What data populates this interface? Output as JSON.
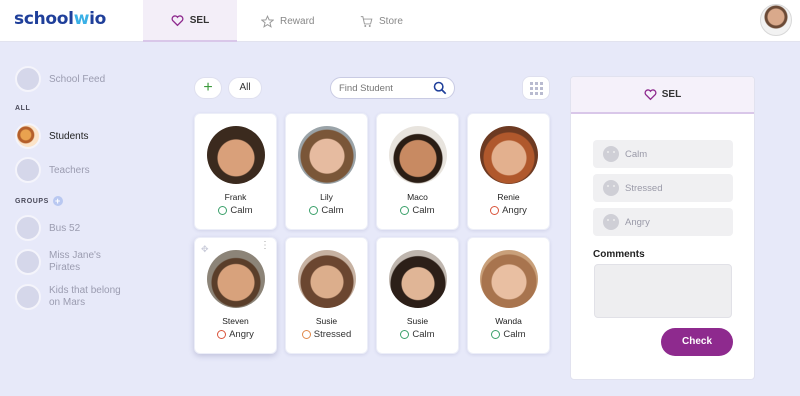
{
  "app": {
    "logo_part1": "school",
    "logo_part2": "w",
    "logo_part3": "io"
  },
  "nav": {
    "tabs": [
      {
        "label": "SEL",
        "icon": "heart-icon",
        "active": true
      },
      {
        "label": "Reward",
        "icon": "star-icon",
        "active": false
      },
      {
        "label": "Store",
        "icon": "cart-icon",
        "active": false
      }
    ]
  },
  "sidebar": {
    "school_feed": "School Feed",
    "all_section": "ALL",
    "students": "Students",
    "teachers": "Teachers",
    "groups_section": "GROUPS",
    "groups": [
      "Bus 52",
      "Miss Jane's Pirates",
      "Kids that belong on Mars"
    ]
  },
  "toolbar": {
    "add_label": "+",
    "all_label": "All",
    "search_placeholder": "Find Student"
  },
  "students": [
    {
      "name": "Frank",
      "mood": "Calm"
    },
    {
      "name": "Lily",
      "mood": "Calm"
    },
    {
      "name": "Maco",
      "mood": "Calm"
    },
    {
      "name": "Renie",
      "mood": "Angry"
    },
    {
      "name": "Steven",
      "mood": "Angry"
    },
    {
      "name": "Susie",
      "mood": "Stressed"
    },
    {
      "name": "Susie",
      "mood": "Calm"
    },
    {
      "name": "Wanda",
      "mood": "Calm"
    }
  ],
  "panel": {
    "title": "SEL",
    "options": [
      "Calm",
      "Stressed",
      "Angry"
    ],
    "comments_label": "Comments",
    "check_label": "Check"
  },
  "colors": {
    "accent": "#8e2a8e",
    "background": "#e7e9f9",
    "calm": "#3aa06a",
    "angry": "#d9533a",
    "stressed": "#e0894a"
  }
}
